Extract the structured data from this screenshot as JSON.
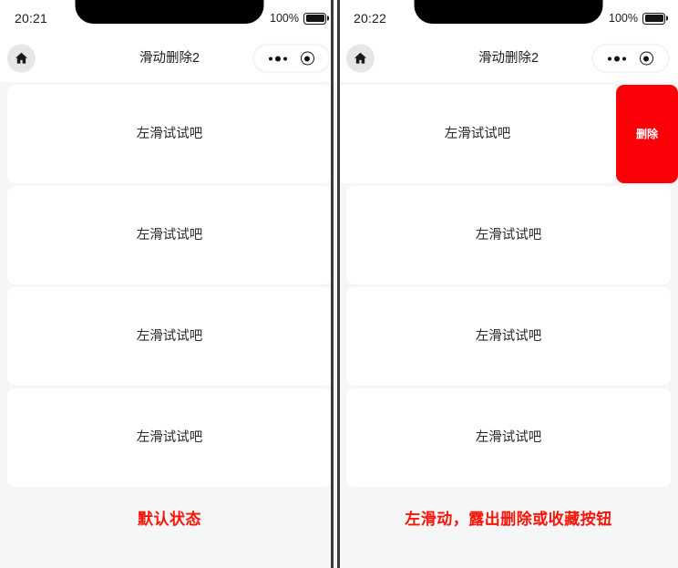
{
  "panels": [
    {
      "id": "default-state",
      "status": {
        "time": "20:21",
        "battery_percent": "100%",
        "battery_icon": "battery-full-icon"
      },
      "navbar": {
        "home_icon": "home-icon",
        "title": "滑动删除2",
        "capsule": {
          "more_icon": "more-dots-icon",
          "target_icon": "target-circle-icon"
        }
      },
      "list": [
        {
          "label": "左滑试试吧",
          "swiped": false
        },
        {
          "label": "左滑试试吧",
          "swiped": false
        },
        {
          "label": "左滑试试吧",
          "swiped": false
        },
        {
          "label": "左滑试试吧",
          "swiped": false
        }
      ],
      "caption": "默认状态"
    },
    {
      "id": "swiped-state",
      "status": {
        "time": "20:22",
        "battery_percent": "100%",
        "battery_icon": "battery-full-icon"
      },
      "navbar": {
        "home_icon": "home-icon",
        "title": "滑动删除2",
        "capsule": {
          "more_icon": "more-dots-icon",
          "target_icon": "target-circle-icon"
        }
      },
      "list": [
        {
          "label": "左滑试试吧",
          "swiped": true,
          "action_label": "删除"
        },
        {
          "label": "左滑试试吧",
          "swiped": false
        },
        {
          "label": "左滑试试吧",
          "swiped": false
        },
        {
          "label": "左滑试试吧",
          "swiped": false
        }
      ],
      "caption": "左滑动，露出删除或收藏按钮"
    }
  ],
  "colors": {
    "delete_button": "#fb0007",
    "caption_text": "#fb1405",
    "page_background": "#f5f6f8",
    "card_background": "#ffffff",
    "divider": "#3a3a3c"
  }
}
